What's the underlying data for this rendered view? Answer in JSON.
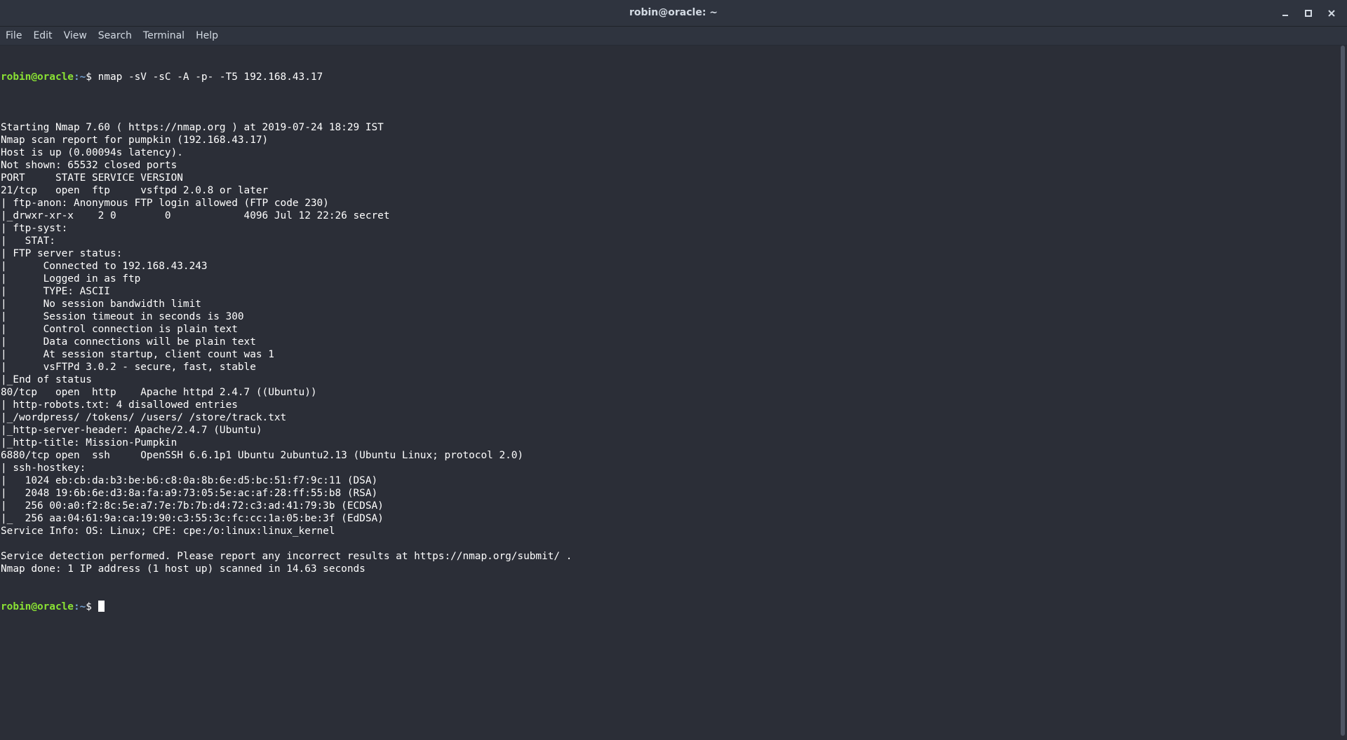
{
  "window": {
    "title": "robin@oracle: ~",
    "controls": [
      {
        "name": "minimize-button",
        "icon": "minimize-icon"
      },
      {
        "name": "maximize-button",
        "icon": "maximize-icon"
      },
      {
        "name": "close-button",
        "icon": "close-icon"
      }
    ]
  },
  "menu": {
    "items": [
      "File",
      "Edit",
      "View",
      "Search",
      "Terminal",
      "Help"
    ]
  },
  "prompt": {
    "user_host": "robin@oracle",
    "path": ":~",
    "symbol": "$ "
  },
  "terminal": {
    "command": "nmap -sV -sC -A -p- -T5 192.168.43.17",
    "output": [
      "",
      "Starting Nmap 7.60 ( https://nmap.org ) at 2019-07-24 18:29 IST",
      "Nmap scan report for pumpkin (192.168.43.17)",
      "Host is up (0.00094s latency).",
      "Not shown: 65532 closed ports",
      "PORT     STATE SERVICE VERSION",
      "21/tcp   open  ftp     vsftpd 2.0.8 or later",
      "| ftp-anon: Anonymous FTP login allowed (FTP code 230)",
      "|_drwxr-xr-x    2 0        0            4096 Jul 12 22:26 secret",
      "| ftp-syst:",
      "|   STAT:",
      "| FTP server status:",
      "|      Connected to 192.168.43.243",
      "|      Logged in as ftp",
      "|      TYPE: ASCII",
      "|      No session bandwidth limit",
      "|      Session timeout in seconds is 300",
      "|      Control connection is plain text",
      "|      Data connections will be plain text",
      "|      At session startup, client count was 1",
      "|      vsFTPd 3.0.2 - secure, fast, stable",
      "|_End of status",
      "80/tcp   open  http    Apache httpd 2.4.7 ((Ubuntu))",
      "| http-robots.txt: 4 disallowed entries",
      "|_/wordpress/ /tokens/ /users/ /store/track.txt",
      "|_http-server-header: Apache/2.4.7 (Ubuntu)",
      "|_http-title: Mission-Pumpkin",
      "6880/tcp open  ssh     OpenSSH 6.6.1p1 Ubuntu 2ubuntu2.13 (Ubuntu Linux; protocol 2.0)",
      "| ssh-hostkey:",
      "|   1024 eb:cb:da:b3:be:b6:c8:0a:8b:6e:d5:bc:51:f7:9c:11 (DSA)",
      "|   2048 19:6b:6e:d3:8a:fa:a9:73:05:5e:ac:af:28:ff:55:b8 (RSA)",
      "|   256 00:a0:f2:8c:5e:a7:7e:7b:7b:d4:72:c3:ad:41:79:3b (ECDSA)",
      "|_  256 aa:04:61:9a:ca:19:90:c3:55:3c:fc:cc:1a:05:be:3f (EdDSA)",
      "Service Info: OS: Linux; CPE: cpe:/o:linux:linux_kernel",
      "",
      "Service detection performed. Please report any incorrect results at https://nmap.org/submit/ .",
      "Nmap done: 1 IP address (1 host up) scanned in 14.63 seconds"
    ]
  },
  "colors": {
    "background": "#2b2e37",
    "prompt_user": "#8ae234",
    "prompt_path": "#729fcf",
    "text": "#ffffff"
  }
}
